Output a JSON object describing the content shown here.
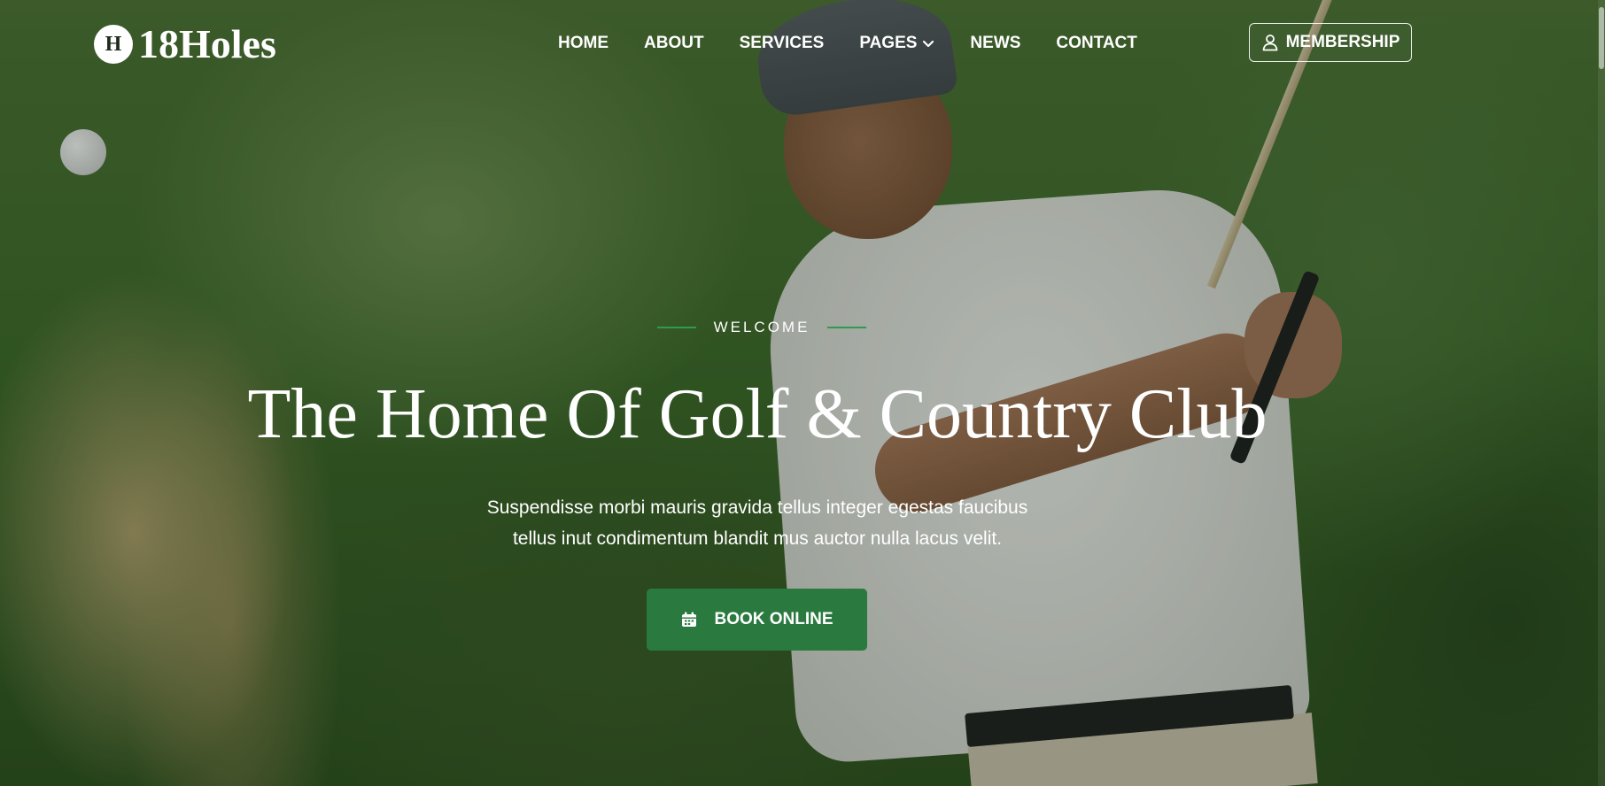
{
  "brand": {
    "mark_letter": "H",
    "name": "18Holes"
  },
  "nav": {
    "items": [
      {
        "label": "HOME"
      },
      {
        "label": "ABOUT"
      },
      {
        "label": "SERVICES"
      },
      {
        "label": "PAGES",
        "has_dropdown": true
      },
      {
        "label": "NEWS"
      },
      {
        "label": "CONTACT"
      }
    ],
    "membership_label": "MEMBERSHIP",
    "membership_icon": "user-icon",
    "dropdown_icon": "chevron-down-icon"
  },
  "hero": {
    "eyebrow": "WELCOME",
    "title": "The Home Of Golf & Country Club",
    "subtitle_line1": "Suspendisse morbi mauris gravida tellus integer egestas faucibus",
    "subtitle_line2": "tellus inut condimentum blandit mus auctor nulla lacus velit.",
    "cta_label": "BOOK ONLINE",
    "cta_icon": "calendar-icon"
  },
  "colors": {
    "accent_green": "#2a7a3f",
    "eyebrow_line": "#2e9b4e",
    "text": "#ffffff"
  }
}
